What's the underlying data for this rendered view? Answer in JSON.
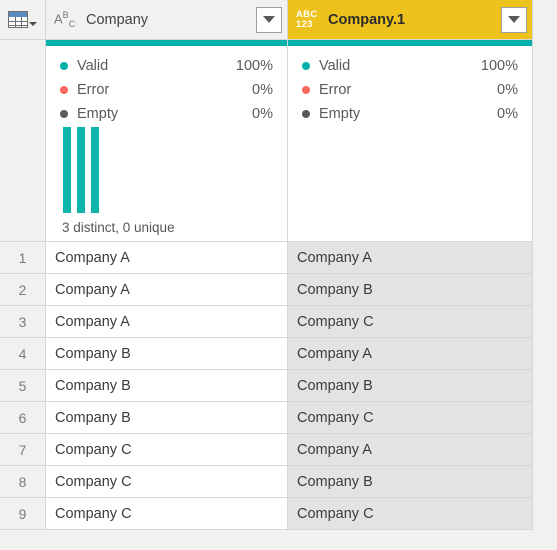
{
  "grid_icon": {
    "name": "table-grid-icon",
    "caret": "caret-down-icon"
  },
  "columns": [
    {
      "name": "Company",
      "type_icon_label": "ABC",
      "type_icon_name": "text-type-icon",
      "selected": false,
      "dropdown_icon": "caret-down-icon",
      "quality": {
        "bar_color": "#00b2a9",
        "rows": [
          {
            "label": "Valid",
            "value": "100%",
            "dot_color": "#00b2a9"
          },
          {
            "label": "Error",
            "value": "0%",
            "dot_color": "#f6695e"
          },
          {
            "label": "Empty",
            "value": "0%",
            "dot_color": "#5a5a5a"
          }
        ]
      },
      "distribution": {
        "bar_color": "#0bb5ac",
        "bars": [
          100,
          100,
          100
        ],
        "summary": "3 distinct, 0 unique"
      }
    },
    {
      "name": "Company.1",
      "type_icon_label_top": "ABC",
      "type_icon_label_bottom": "123",
      "type_icon_name": "any-type-icon",
      "selected": true,
      "header_color": "#edc21d",
      "dropdown_icon": "caret-down-icon",
      "quality": {
        "bar_color": "#00b2a9",
        "rows": [
          {
            "label": "Valid",
            "value": "100%",
            "dot_color": "#00b2a9"
          },
          {
            "label": "Error",
            "value": "0%",
            "dot_color": "#f6695e"
          },
          {
            "label": "Empty",
            "value": "0%",
            "dot_color": "#5a5a5a"
          }
        ]
      },
      "distribution": null
    }
  ],
  "rows": [
    {
      "num": "1",
      "c1": "Company A",
      "c2": "Company A"
    },
    {
      "num": "2",
      "c1": "Company A",
      "c2": "Company B"
    },
    {
      "num": "3",
      "c1": "Company A",
      "c2": "Company C"
    },
    {
      "num": "4",
      "c1": "Company B",
      "c2": "Company A"
    },
    {
      "num": "5",
      "c1": "Company B",
      "c2": "Company B"
    },
    {
      "num": "6",
      "c1": "Company B",
      "c2": "Company C"
    },
    {
      "num": "7",
      "c1": "Company C",
      "c2": "Company A"
    },
    {
      "num": "8",
      "c1": "Company C",
      "c2": "Company B"
    },
    {
      "num": "9",
      "c1": "Company C",
      "c2": "Company C"
    }
  ]
}
